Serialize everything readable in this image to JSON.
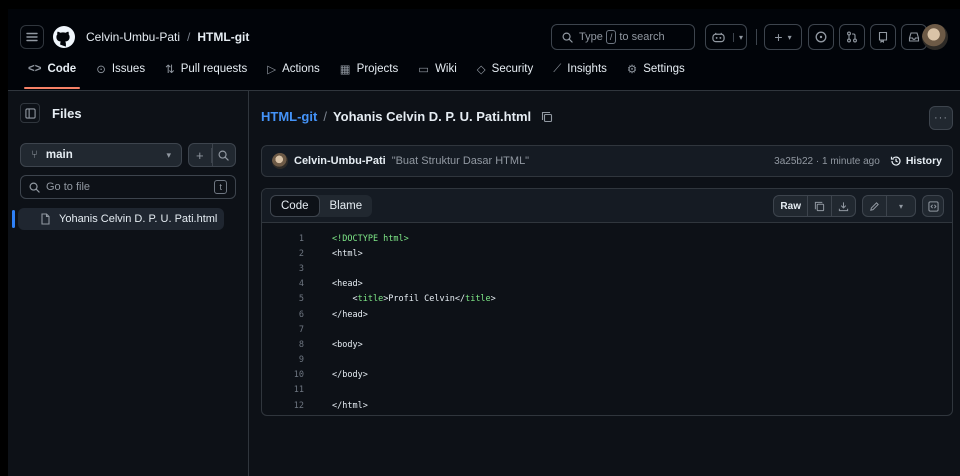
{
  "header": {
    "owner": "Celvin-Umbu-Pati",
    "separator": "/",
    "repo": "HTML-git",
    "search_prefix": "Type",
    "search_key": "/",
    "search_suffix": "to search"
  },
  "nav": {
    "items": [
      {
        "label": "Code",
        "icon": "code-icon"
      },
      {
        "label": "Issues",
        "icon": "issue-icon"
      },
      {
        "label": "Pull requests",
        "icon": "pull-request-icon"
      },
      {
        "label": "Actions",
        "icon": "actions-icon"
      },
      {
        "label": "Projects",
        "icon": "projects-icon"
      },
      {
        "label": "Wiki",
        "icon": "wiki-icon"
      },
      {
        "label": "Security",
        "icon": "shield-icon"
      },
      {
        "label": "Insights",
        "icon": "graph-icon"
      },
      {
        "label": "Settings",
        "icon": "gear-icon"
      }
    ]
  },
  "sidebar": {
    "title": "Files",
    "branch": "main",
    "goto_placeholder": "Go to file",
    "goto_key": "t",
    "files": [
      "Yohanis Celvin D. P. U. Pati.html"
    ]
  },
  "file": {
    "repo": "HTML-git",
    "separator": "/",
    "name": "Yohanis Celvin D. P. U. Pati.html"
  },
  "commit": {
    "author": "Celvin-Umbu-Pati",
    "message": "\"Buat Struktur Dasar HTML\"",
    "meta": "3a25b22 · 1 minute ago",
    "history_label": "History"
  },
  "code_view": {
    "tab_code": "Code",
    "tab_blame": "Blame",
    "raw_label": "Raw"
  },
  "colors": {
    "accent_link": "#4493f8",
    "tag_green": "#7ee787",
    "active_underline": "#f78166"
  }
}
